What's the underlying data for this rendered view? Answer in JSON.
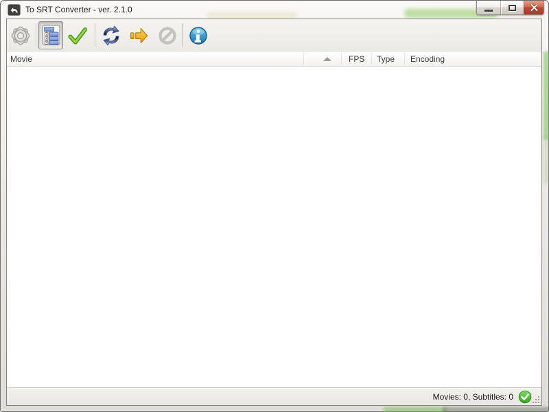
{
  "window": {
    "title": "To SRT Converter - ver. 2.1.0",
    "app_icon": "curved-arrow-icon",
    "controls": [
      {
        "id": "minimize",
        "icon": "minimize-dash-icon"
      },
      {
        "id": "maximize",
        "icon": "maximize-square-icon"
      },
      {
        "id": "close",
        "icon": "close-x-icon"
      }
    ]
  },
  "toolbar": {
    "buttons": [
      {
        "id": "settings",
        "icon": "gear-icon",
        "enabled": true,
        "pressed": false
      },
      {
        "id": "view-list",
        "icon": "tree-list-icon",
        "enabled": true,
        "pressed": true
      },
      {
        "id": "validate",
        "icon": "green-check-icon",
        "enabled": true,
        "pressed": false
      },
      {
        "id": "refresh",
        "icon": "refresh-arrows-icon",
        "enabled": true,
        "pressed": false
      },
      {
        "id": "convert",
        "icon": "orange-arrow-icon",
        "enabled": true,
        "pressed": false
      },
      {
        "id": "cancel",
        "icon": "blocked-circle-icon",
        "enabled": false,
        "pressed": false
      },
      {
        "id": "about",
        "icon": "info-icon",
        "enabled": true,
        "pressed": false
      }
    ]
  },
  "table": {
    "columns": [
      {
        "label": "Movie",
        "sort": "asc"
      },
      {
        "label": "FPS",
        "sort": null
      },
      {
        "label": "Type",
        "sort": null
      },
      {
        "label": "Encoding",
        "sort": null
      }
    ],
    "rows": []
  },
  "status": {
    "text": "Movies: 0, Subtitles: 0",
    "icon": "status-ok-icon"
  },
  "colors": {
    "close_button": "#c24731",
    "accent_blue": "#2f89c0",
    "accent_green": "#53b636",
    "accent_orange": "#f59d0e",
    "toolbar_bg": "#f0eeea",
    "header_text": "#3a3a3a"
  }
}
